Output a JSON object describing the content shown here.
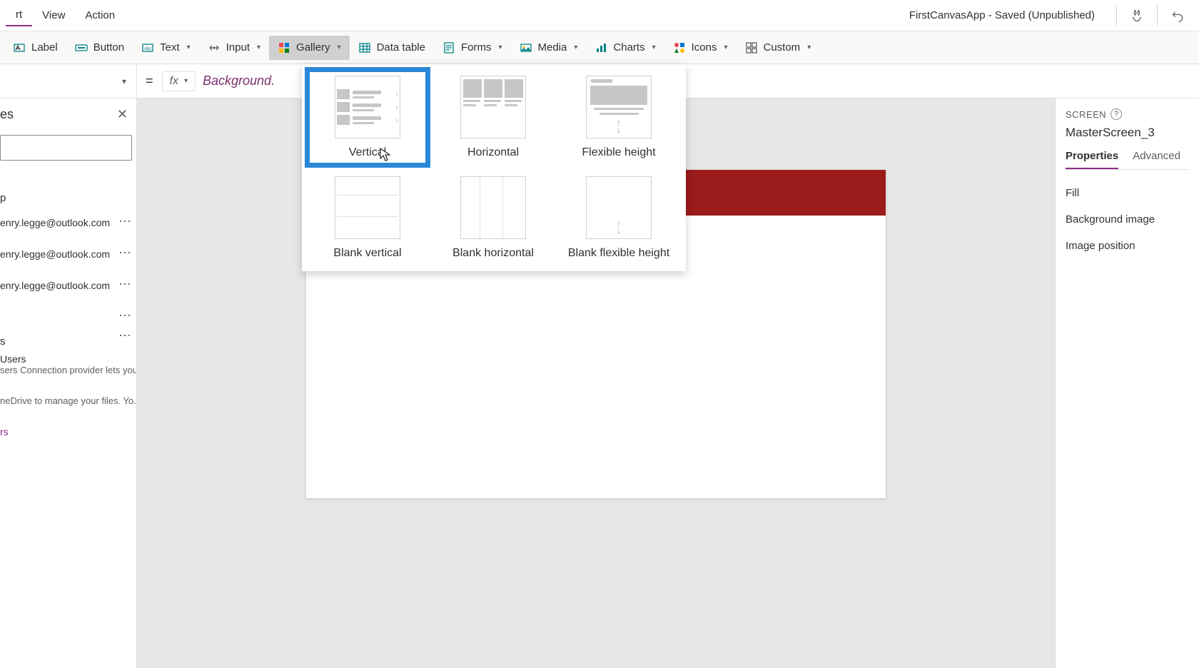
{
  "menubar": {
    "items": [
      "rt",
      "View",
      "Action"
    ],
    "app_title": "FirstCanvasApp - Saved (Unpublished)"
  },
  "ribbon": {
    "label": {
      "text": "Label"
    },
    "button": {
      "text": "Button"
    },
    "text": {
      "text": "Text"
    },
    "input": {
      "text": "Input"
    },
    "gallery": {
      "text": "Gallery"
    },
    "datatable": {
      "text": "Data table"
    },
    "forms": {
      "text": "Forms"
    },
    "media": {
      "text": "Media"
    },
    "charts": {
      "text": "Charts"
    },
    "icons": {
      "text": "Icons"
    },
    "custom": {
      "text": "Custom"
    }
  },
  "formula": {
    "equals": "=",
    "fx": "fx",
    "text": "Background."
  },
  "left_panel": {
    "title": "es",
    "items": [
      {
        "label": "p"
      },
      {
        "label": "enry.legge@outlook.com"
      },
      {
        "label": "enry.legge@outlook.com"
      },
      {
        "label": "enry.legge@outlook.com"
      },
      {
        "label": ""
      },
      {
        "label": "s"
      }
    ],
    "users": {
      "title": "Users",
      "desc": "sers Connection provider lets you ..."
    },
    "onedrive": {
      "desc": "neDrive to manage your files. Yo..."
    },
    "last": "rs"
  },
  "gallery_dropdown": {
    "options": [
      {
        "label": "Vertical",
        "selected": true
      },
      {
        "label": "Horizontal",
        "selected": false
      },
      {
        "label": "Flexible height",
        "selected": false
      },
      {
        "label": "Blank vertical",
        "selected": false
      },
      {
        "label": "Blank horizontal",
        "selected": false
      },
      {
        "label": "Blank flexible height",
        "selected": false
      }
    ]
  },
  "right_panel": {
    "section": "SCREEN",
    "screen_name": "MasterScreen_3",
    "tabs": [
      "Properties",
      "Advanced"
    ],
    "props": [
      "Fill",
      "Background image",
      "Image position"
    ]
  }
}
